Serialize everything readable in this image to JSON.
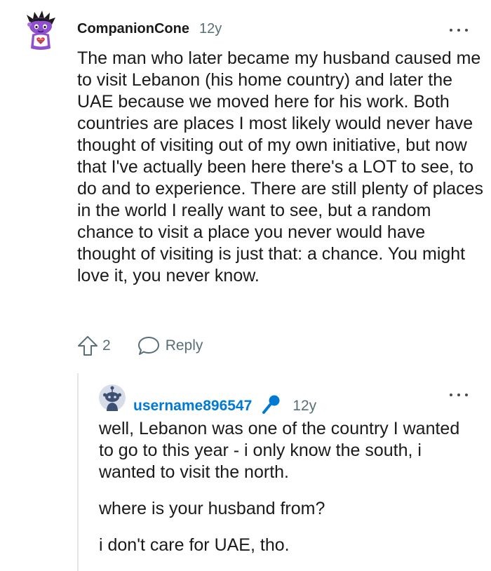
{
  "top_comment": {
    "author": "CompanionCone",
    "age": "12y",
    "body": "The man who later became my husband caused me to visit Lebanon (his home country) and later the UAE because we moved here for his work. Both countries are places I most likely would never have thought of visiting out of my own initiative, but now that I've actually been here there's a LOT to see, to do and to experience. There are still plenty of places in the world I really want to see, but a random chance to visit a place you never would have thought of visiting is just that: a chance. You might love it, you never know.",
    "vote_count": "2",
    "reply_label": "Reply"
  },
  "reply_comment": {
    "author": "username896547",
    "age": "12y",
    "paragraphs": [
      "well, Lebanon was one of the country I wanted to go to this year - i only know the south, i wanted to visit the north.",
      "where is your husband from?",
      "i don't care for UAE, tho."
    ]
  },
  "colors": {
    "reply_author": "#0079d3",
    "meta_gray": "#576f76",
    "avatar_purple": "#7b3fbf",
    "thread_line": "#e3e5e8"
  },
  "icons": {
    "upvote": "upvote-arrow-icon",
    "reply": "speech-bubble-icon",
    "more": "ellipsis-icon",
    "mic": "microphone-icon"
  }
}
